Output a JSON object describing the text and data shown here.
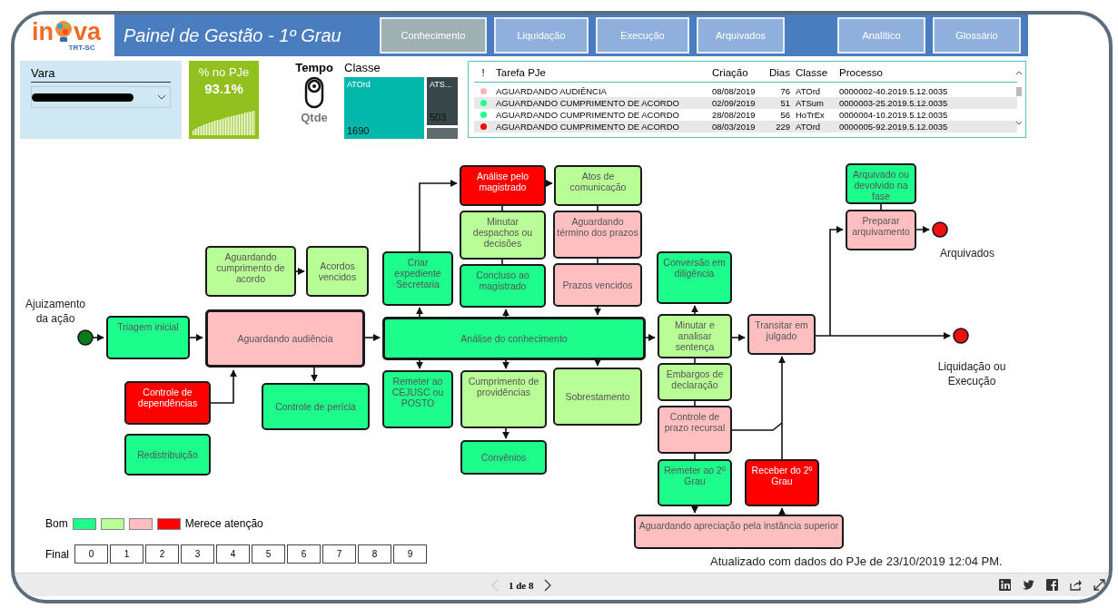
{
  "logo": {
    "left": "in",
    "right": "va",
    "tagline": "TRT-SC"
  },
  "header": {
    "title": "Painel de Gestão - 1º Grau",
    "tabs": [
      {
        "label": "Conhecimento",
        "selected": true
      },
      {
        "label": "Liquidação",
        "selected": false
      },
      {
        "label": "Execução",
        "selected": false
      },
      {
        "label": "Arquivados",
        "selected": false
      },
      {
        "label": "Analítico",
        "selected": false
      },
      {
        "label": "Glossário",
        "selected": false
      }
    ]
  },
  "vara": {
    "label": "Vara",
    "value_redacted": true
  },
  "kpi": {
    "title": "% no PJe",
    "value": "93.1%"
  },
  "toggle": {
    "options": [
      {
        "label": "Tempo",
        "selected": true
      },
      {
        "label": "Qtde",
        "selected": false
      }
    ]
  },
  "classe": {
    "title": "Classe",
    "tiles": [
      {
        "label": "ATOrd",
        "value": "1690",
        "color": "#01b8aa"
      },
      {
        "label": "ATS...",
        "value": "503",
        "color": "#374649"
      },
      {
        "color": "#5f6b6d"
      }
    ]
  },
  "tasks": {
    "flag_column": "!",
    "columns": [
      "Tarefa PJe",
      "Criação",
      "Dias",
      "Classe",
      "Processo"
    ],
    "rows": [
      {
        "color": "#ffb3b8",
        "cells": [
          "AGUARDANDO AUDIÊNCIA",
          "08/08/2019",
          "76",
          "ATOrd",
          "0000002-40.2019.5.12.0035"
        ]
      },
      {
        "color": "#1dfd8c",
        "cells": [
          "AGUARDANDO CUMPRIMENTO DE ACORDO",
          "02/09/2019",
          "51",
          "ATSum",
          "0000003-25.2019.5.12.0035"
        ]
      },
      {
        "color": "#1dfd8c",
        "cells": [
          "AGUARDANDO CUMPRIMENTO DE ACORDO",
          "28/08/2019",
          "56",
          "HoTrEx",
          "0000004-10.2019.5.12.0035"
        ]
      },
      {
        "color": "#ff0000",
        "cells": [
          "AGUARDANDO CUMPRIMENTO DE ACORDO",
          "08/03/2019",
          "229",
          "ATOrd",
          "0000005-92.2019.5.12.0035"
        ]
      }
    ]
  },
  "flow": {
    "start_label": "Ajuizamento da ação",
    "end_labels": [
      "Arquivados",
      "Liquidação ou Execução"
    ],
    "nodes": [
      {
        "label": "Análise pelo magistrado",
        "color": "#ff0000"
      },
      {
        "label": "Atos de comunicação",
        "color": "#b9fd96"
      },
      {
        "label": "Arquivado ou devolvido na fase",
        "color": "#1dfd8c"
      },
      {
        "label": "Minutar despachos ou decisões",
        "color": "#b9fd96"
      },
      {
        "label": "Aguardando término dos prazos",
        "color": "#ffbfc1"
      },
      {
        "label": "Preparar arquivamento",
        "color": "#ffbfc1"
      },
      {
        "label": "Aguardando cumprimento de acordo",
        "color": "#b9fd96"
      },
      {
        "label": "Acordos vencidos",
        "color": "#b9fd96"
      },
      {
        "label": "Criar expediente Secretaria",
        "color": "#1dfd8c"
      },
      {
        "label": "Conversão em diligência",
        "color": "#1dfd8c"
      },
      {
        "label": "Concluso ao magistrado",
        "color": "#1dfd8c"
      },
      {
        "label": "Prazos vencidos",
        "color": "#ffbfc1"
      },
      {
        "label": "Triagem inicial",
        "color": "#1dfd8c"
      },
      {
        "label": "Aguardando audiência",
        "color": "#ffbfc1"
      },
      {
        "label": "Análise do conhecimento",
        "color": "#1dfd8c"
      },
      {
        "label": "Minutar e analisar sentença",
        "color": "#b9fd96"
      },
      {
        "label": "Transitar em julgado",
        "color": "#ffbfc1"
      },
      {
        "label": "Remeter ao CEJUSC ou POSTO",
        "color": "#1dfd8c"
      },
      {
        "label": "Cumprimento de providências",
        "color": "#b9fd96"
      },
      {
        "label": "Sobrestamento",
        "color": "#b9fd96"
      },
      {
        "label": "Embargos de declaração",
        "color": "#b9fd96"
      },
      {
        "label": "Controle de dependências",
        "color": "#ff0000"
      },
      {
        "label": "Controle de perícia",
        "color": "#1dfd8c"
      },
      {
        "label": "Controle de prazo recursal",
        "color": "#ffbfc1"
      },
      {
        "label": "Redistribuição",
        "color": "#1dfd8c"
      },
      {
        "label": "Convênios",
        "color": "#1dfd8c"
      },
      {
        "label": "Remeter ao 2º Grau",
        "color": "#1dfd8c"
      },
      {
        "label": "Receber do 2º Grau",
        "color": "#ff0000"
      },
      {
        "label": "Aguardando apreciação pela instância superior",
        "color": "#ffbfc1"
      }
    ]
  },
  "legend": {
    "left": "Bom",
    "right": "Merece atenção",
    "swatches": [
      {
        "color": "#1dfd8c"
      },
      {
        "color": "#b9fd96"
      },
      {
        "color": "#ffbfc1"
      },
      {
        "color": "#ff0000"
      }
    ]
  },
  "final": {
    "label": "Final",
    "digits": [
      "0",
      "1",
      "2",
      "3",
      "4",
      "5",
      "6",
      "7",
      "8",
      "9"
    ]
  },
  "updated": "Atualizado com dados do PJe de 23/10/2019 12:04 PM.",
  "pager": {
    "text": "1 de 8"
  }
}
